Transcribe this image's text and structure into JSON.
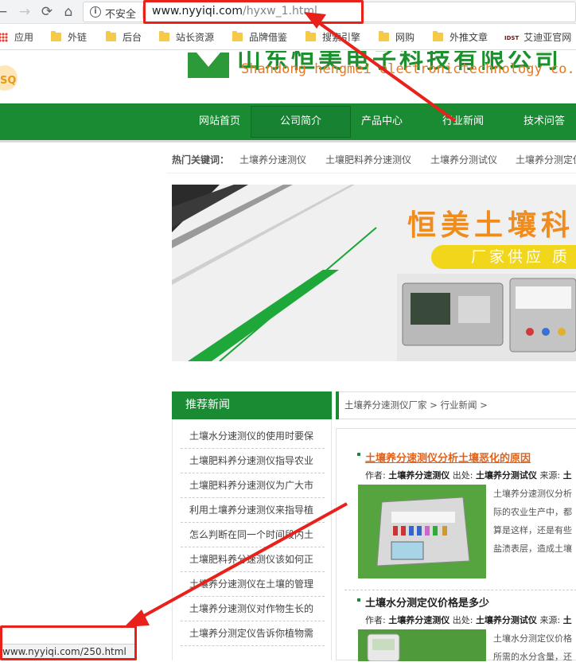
{
  "browser": {
    "insecure_label": "不安全",
    "url_domain": "www.nyyiqi.com",
    "url_path": "/hyxw_1.html",
    "bookmarks": [
      "应用",
      "外链",
      "后台",
      "站长资源",
      "品牌借鉴",
      "搜索引擎",
      "网购",
      "外推文章",
      "艾迪亚官网"
    ],
    "idst_badge": "IDST",
    "status_url": "www.nyyiqi.com/250.html"
  },
  "site": {
    "company_cn": "山东恒美电子科技有限公司",
    "company_en": "Shandong hengmei electronictechnology co.,LTD",
    "nav": [
      "网站首页",
      "公司简介",
      "产品中心",
      "行业新闻",
      "技术问答"
    ],
    "hot_label": "热门关键词：",
    "hot_keywords": [
      "土壤养分速测仪",
      "土壤肥料养分速测仪",
      "土壤养分测试仪",
      "土壤养分测定仪"
    ],
    "banner_title": "恒美土壤科",
    "banner_sub": "厂家供应 质"
  },
  "recommend": {
    "heading": "推荐新闻",
    "items": [
      "土壤水分速测仪的使用时要保",
      "土壤肥料养分速测仪指导农业",
      "土壤肥料养分速测仪为广大市",
      "利用土壤养分速测仪来指导植",
      "怎么判断在同一个时间段内土",
      "土壤肥料养分速测仪该如何正",
      "土壤养分速测仪在土壤的管理",
      "土壤养分速测仪对作物生长的",
      "土壤养分测定仪告诉你植物需"
    ]
  },
  "crumb": {
    "home": "土壤养分速测仪厂家",
    "sep": ">",
    "current": "行业新闻"
  },
  "news": [
    {
      "title": "土壤养分速测仪分析土壤恶化的原因",
      "meta_author_label": "作者:",
      "meta_author": "土壤养分速测仪",
      "meta_source_label": "出处:",
      "meta_source": "土壤养分测试仪",
      "meta_from_label": "来源:",
      "meta_from": "土",
      "excerpt": [
        "土壤养分速测仪分析",
        "际的农业生产中，都",
        "算是这样，还是有些",
        "盐渍表层，造成土壤"
      ]
    },
    {
      "title": "土壤水分测定仪价格是多少",
      "meta_author_label": "作者:",
      "meta_author": "土壤养分速测仪",
      "meta_source_label": "出处:",
      "meta_source": "土壤养分测试仪",
      "meta_from_label": "来源:",
      "meta_from": "土",
      "excerpt": [
        "土壤水分测定仪价格",
        "所需的水分含量，还"
      ]
    }
  ],
  "colors": {
    "brand_green": "#1a8a33",
    "link_orange": "#e2621b",
    "annotation_red": "#e8211b"
  }
}
